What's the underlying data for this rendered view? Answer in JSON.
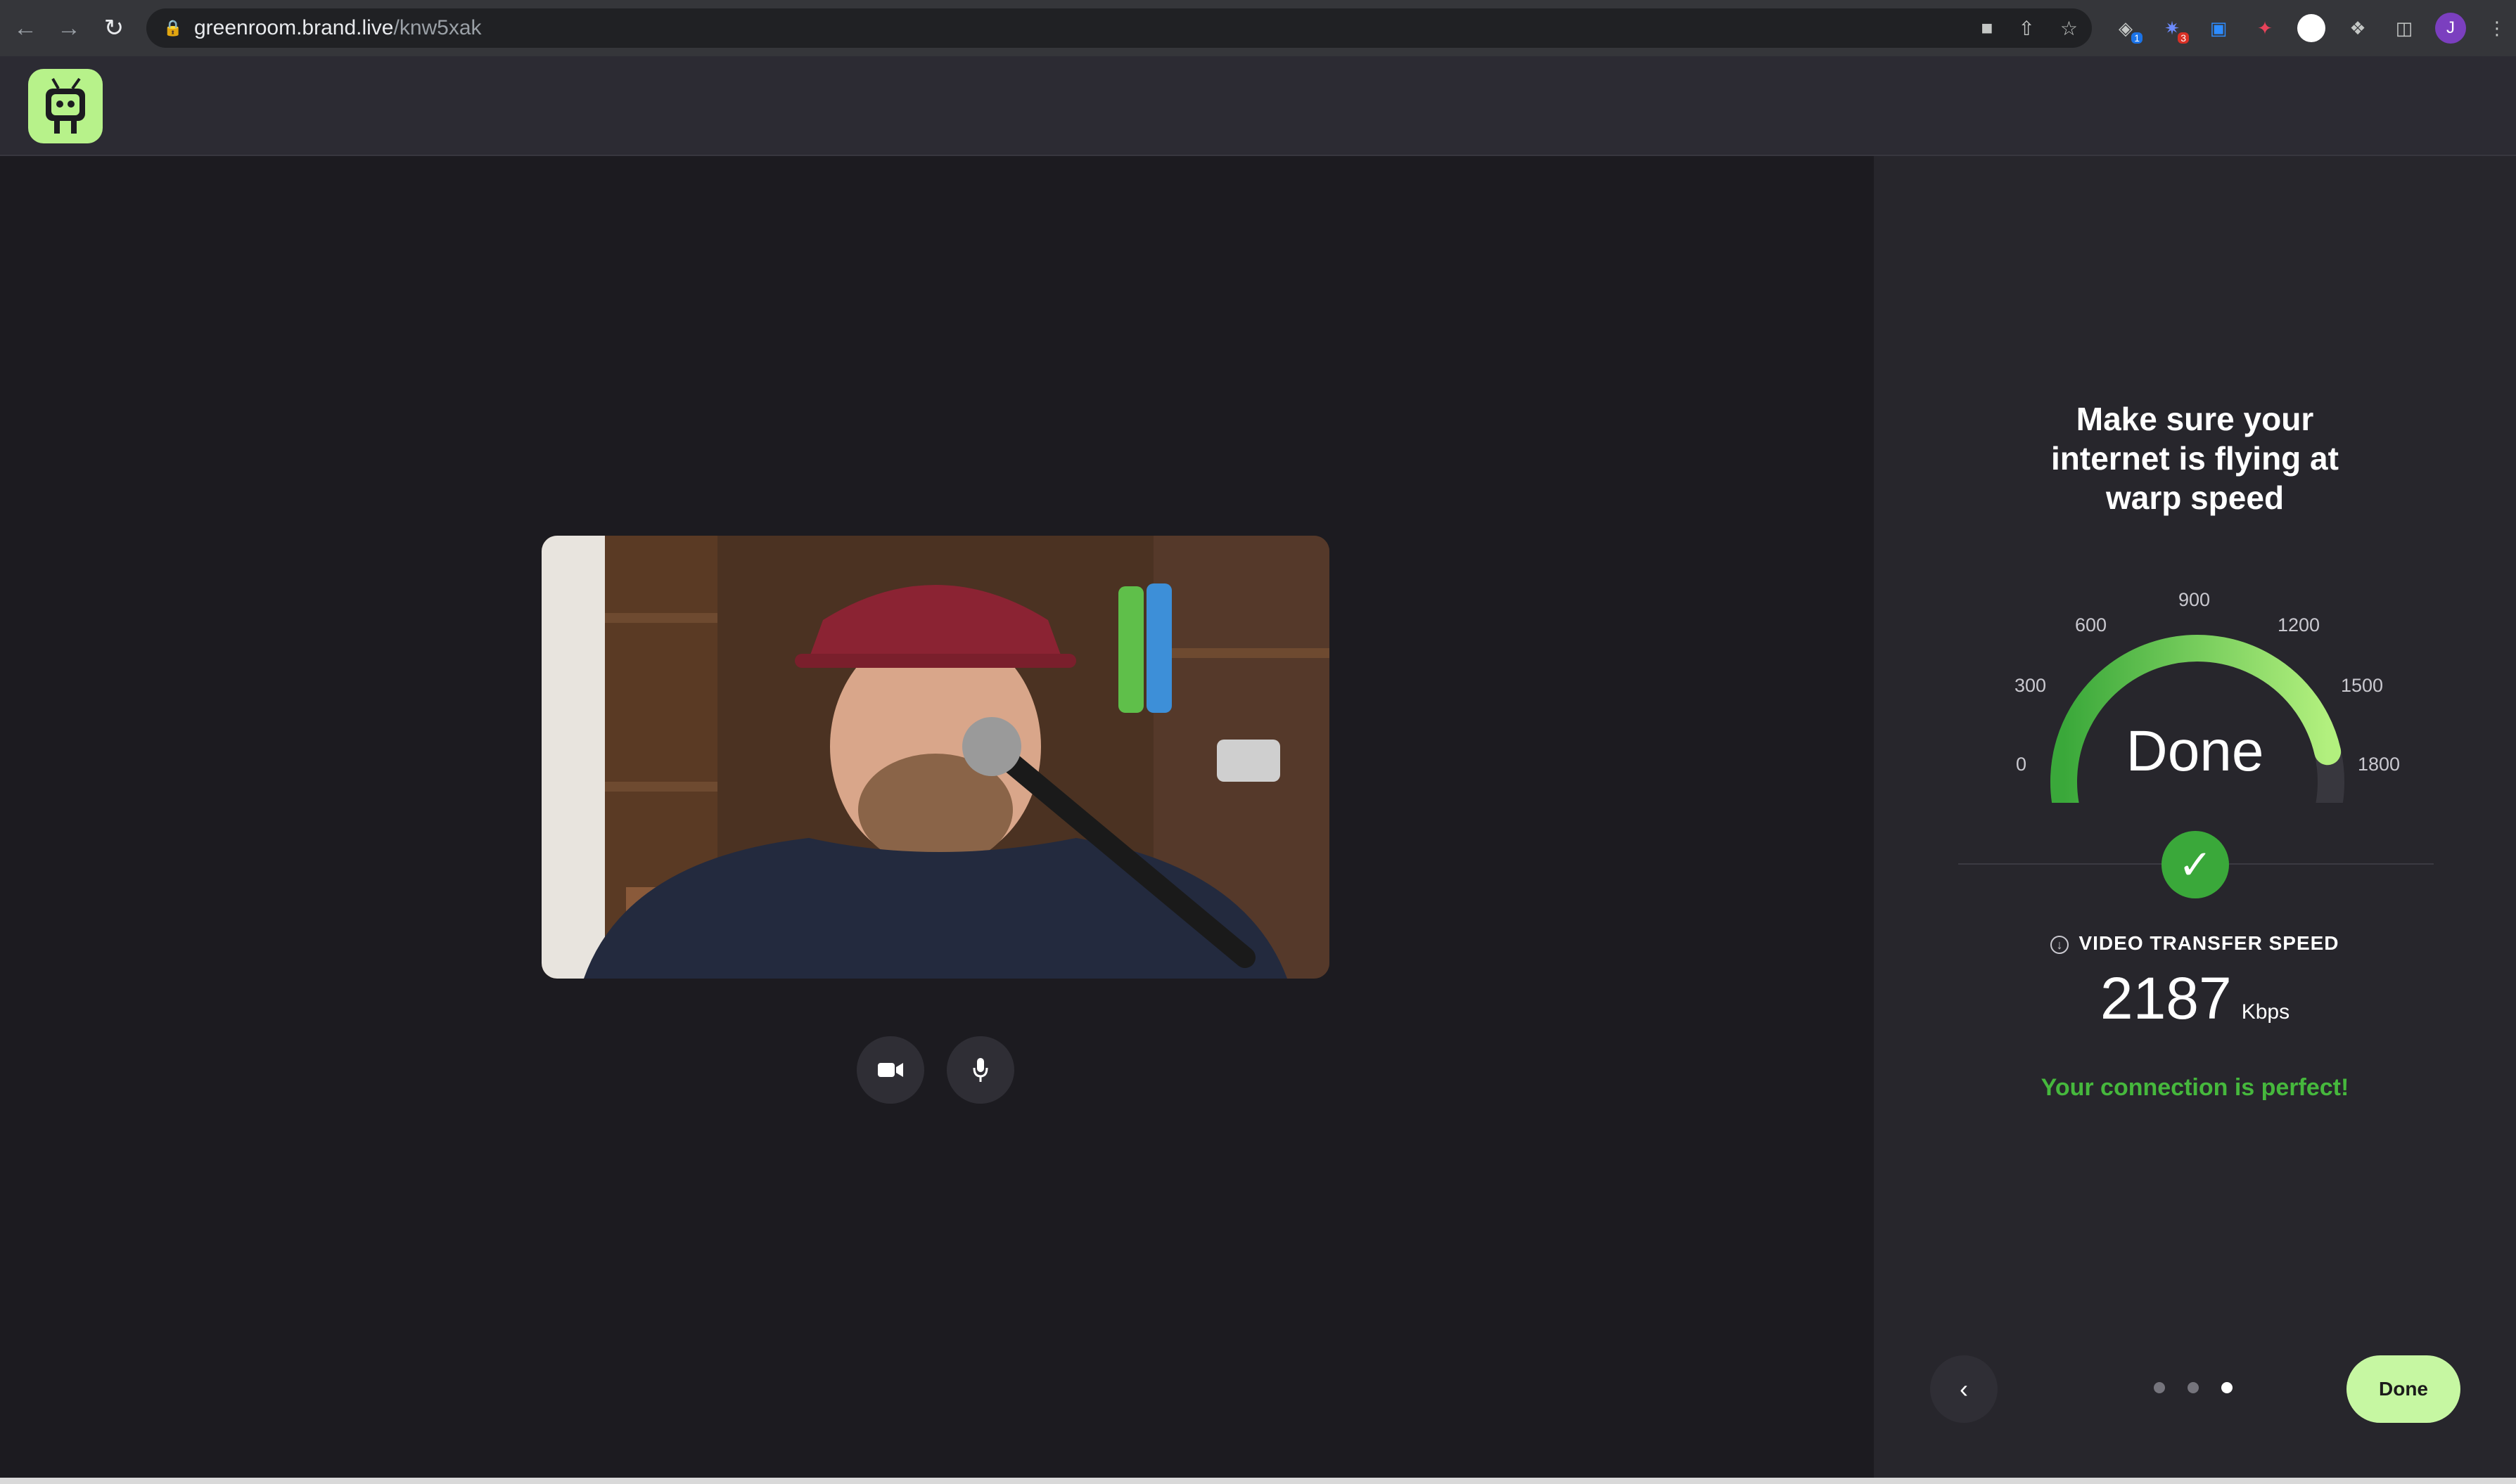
{
  "browser": {
    "url_host": "greenroom.brand.live",
    "url_path": "/knw5xak",
    "profile_initial": "J",
    "extension_badges": [
      "1",
      "3"
    ]
  },
  "panel": {
    "title_lines": [
      "Make sure your",
      "internet is flying at",
      "warp speed"
    ],
    "gauge_ticks": [
      "0",
      "300",
      "600",
      "900",
      "1200",
      "1500",
      "1800"
    ],
    "gauge_status": "Done",
    "gauge_fill": 0.85,
    "speed_label": "VIDEO TRANSFER SPEED",
    "speed_value": "2187",
    "speed_unit": "Kbps",
    "connection_message": "Your connection is perfect!",
    "done_label": "Done",
    "steps_total": 3,
    "step_active": 3
  },
  "colors": {
    "accent_green": "#46b83d",
    "button_green": "#c6f7a2",
    "logo_green": "#b7f28a"
  }
}
